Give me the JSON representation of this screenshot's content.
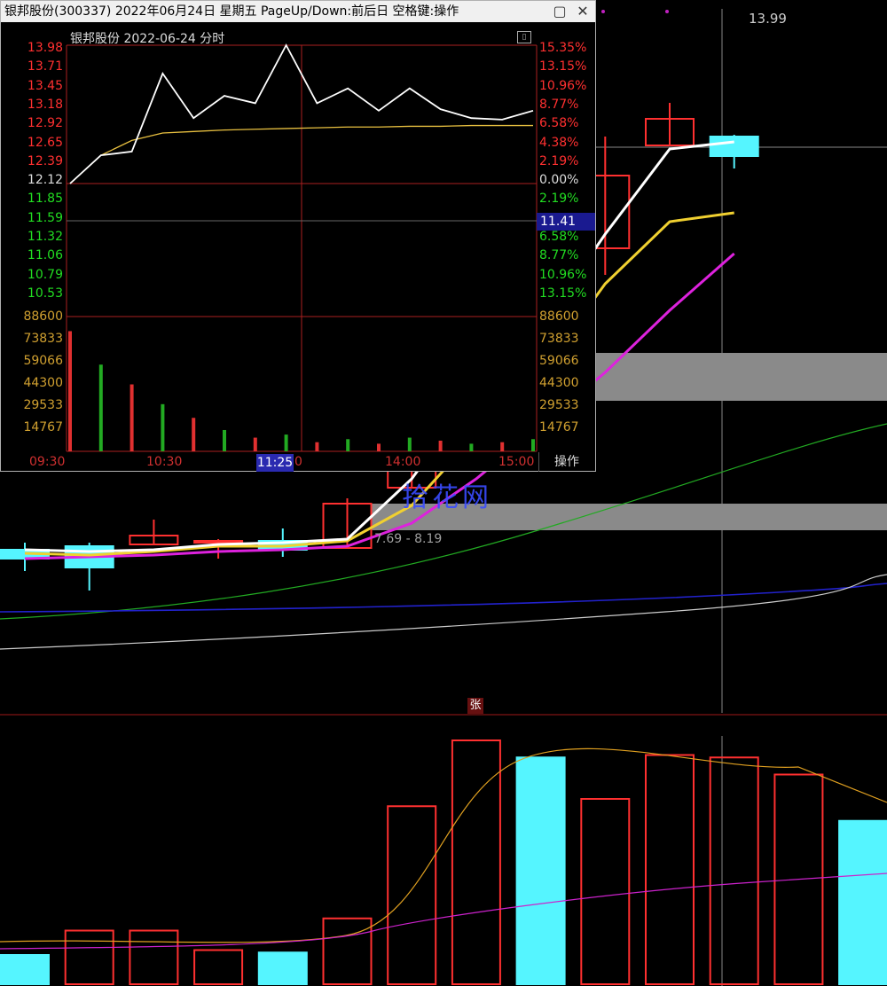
{
  "colors": {
    "up": "#ff3030",
    "down": "#55f5ff",
    "ma5": "#ffffff",
    "ma10": "#f0d030",
    "ma20": "#dd22dd",
    "ma60": "#22aa22",
    "ma120": "#2222cc",
    "ma250": "#cccccc",
    "grid": "#aa2020"
  },
  "main_chart": {
    "high_label": "13.99",
    "range_label": "7.69 - 8.19",
    "zhang_badge": "张",
    "watermark": "拾花网"
  },
  "popup": {
    "title": "银邦股份(300337) 2022年06月24日 星期五 PageUp/Down:前后日 空格键:操作",
    "chart_title": "银邦股份   2022-06-24 分时",
    "minimize_icon": "▢",
    "close_icon": "✕",
    "price_ticks": [
      "13.98",
      "13.71",
      "13.45",
      "13.18",
      "12.92",
      "12.65",
      "12.39",
      "12.12",
      "11.85",
      "11.59",
      "11.32",
      "11.06",
      "10.79",
      "10.53"
    ],
    "pct_ticks": [
      "15.35%",
      "13.15%",
      "10.96%",
      "8.77%",
      "6.58%",
      "4.38%",
      "2.19%",
      "0.00%",
      "2.19%",
      "",
      "6.58%",
      "8.77%",
      "10.96%",
      "13.15%"
    ],
    "vol_ticks": [
      "88600",
      "73833",
      "59066",
      "44300",
      "29533",
      "14767"
    ],
    "time_ticks": [
      "09:30",
      "10:30",
      "",
      "14:00",
      "15:00"
    ],
    "cursor_price": "11.41",
    "cursor_time": "11:25",
    "cursor_time_suffix": "0",
    "op_button": "操作"
  },
  "chart_data": [
    {
      "type": "candlestick",
      "candles": [
        {
          "o": 0.2,
          "c": 0.15,
          "h": 0.24,
          "l": 0.08
        },
        {
          "o": 0.22,
          "c": 0.1,
          "h": 0.24,
          "l": -0.03
        },
        {
          "o": 0.23,
          "c": 0.28,
          "h": 0.37,
          "l": 0.23
        },
        {
          "o": 0.24,
          "c": 0.25,
          "h": 0.26,
          "l": 0.15
        },
        {
          "o": 0.25,
          "c": 0.2,
          "h": 0.32,
          "l": 0.16
        },
        {
          "o": 0.21,
          "c": 0.46,
          "h": 0.49,
          "l": 0.21
        },
        {
          "o": 0.55,
          "c": 0.85,
          "h": 0.92,
          "l": 0.55
        },
        {
          "o": 0.92,
          "c": 1.23,
          "h": 1.28,
          "l": 0.9
        },
        {
          "o": 1.37,
          "c": 1.65,
          "h": 1.86,
          "l": 1.3
        },
        {
          "o": 1.9,
          "c": 2.31,
          "h": 2.53,
          "l": 1.75
        },
        {
          "o": 2.48,
          "c": 2.63,
          "h": 2.72,
          "l": 2.48
        },
        {
          "o": 2.53,
          "c": 2.42,
          "h": 2.54,
          "l": 2.35
        }
      ],
      "ma": {
        "ma5": [
          0.2,
          0.19,
          0.2,
          0.23,
          0.24,
          0.26,
          0.6,
          1.1,
          1.45,
          1.98,
          2.46,
          2.5
        ],
        "ma10": [
          0.18,
          0.17,
          0.19,
          0.22,
          0.22,
          0.25,
          0.45,
          0.85,
          1.2,
          1.7,
          2.05,
          2.1
        ],
        "ma20": [
          0.15,
          0.16,
          0.17,
          0.19,
          0.2,
          0.22,
          0.35,
          0.6,
          0.9,
          1.2,
          1.55,
          1.87
        ]
      }
    },
    {
      "type": "line",
      "price": [
        12.12,
        12.5,
        12.55,
        13.6,
        13.0,
        13.3,
        13.2,
        13.98,
        13.2,
        13.4,
        13.1,
        13.4,
        13.12,
        13.0,
        12.98,
        13.1
      ],
      "avg": [
        12.12,
        12.5,
        12.7,
        12.8,
        12.82,
        12.84,
        12.85,
        12.86,
        12.87,
        12.88,
        12.88,
        12.89,
        12.89,
        12.9,
        12.9,
        12.9
      ],
      "volume": [
        79000,
        57000,
        44000,
        31000,
        22000,
        14000,
        9000,
        11000,
        6000,
        8000,
        5000,
        9000,
        7000,
        5000,
        6000,
        8000
      ]
    },
    {
      "type": "bar",
      "volumes": [
        0.12,
        0.22,
        0.22,
        0.14,
        0.13,
        0.27,
        0.73,
        1.0,
        0.93,
        0.76,
        0.94,
        0.93,
        0.86,
        0.67
      ],
      "direction": [
        "down",
        "up",
        "up",
        "up",
        "down",
        "up",
        "up",
        "up",
        "down",
        "up",
        "up",
        "up",
        "up",
        "down"
      ]
    }
  ]
}
